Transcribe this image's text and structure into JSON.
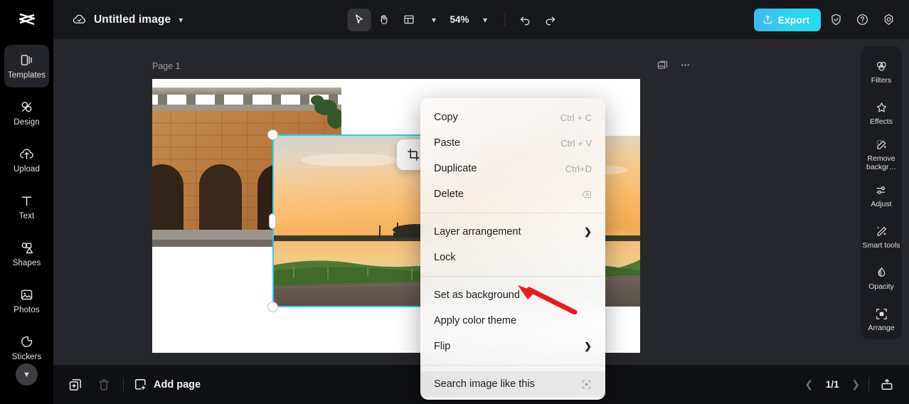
{
  "app": {
    "logo_icon": "capcut-logo-icon",
    "cloud_icon": "cloud-check-icon",
    "doc_title": "Untitled image",
    "title_chevron": "chevron-down-icon"
  },
  "toolbar": {
    "select_tool": "cursor-icon",
    "hand_tool": "hand-icon",
    "layout_tool": "layout-icon",
    "layout_chevron": "chevron-down-icon",
    "zoom_level": "54%",
    "zoom_chevron": "chevron-down-icon",
    "undo": "undo-icon",
    "redo": "redo-icon",
    "export_label": "Export",
    "export_icon": "upload-icon",
    "export_color": "#2ad5ee",
    "shield_icon": "shield-check-icon",
    "help_icon": "question-circle-icon",
    "settings_icon": "settings-gear-icon"
  },
  "sidebar": {
    "items": [
      {
        "label": "Templates",
        "icon": "templates-icon",
        "active": true
      },
      {
        "label": "Design",
        "icon": "design-icon",
        "active": false
      },
      {
        "label": "Upload",
        "icon": "upload-cloud-icon",
        "active": false
      },
      {
        "label": "Text",
        "icon": "text-icon",
        "active": false
      },
      {
        "label": "Shapes",
        "icon": "shapes-icon",
        "active": false
      },
      {
        "label": "Photos",
        "icon": "photos-icon",
        "active": false
      },
      {
        "label": "Stickers",
        "icon": "stickers-icon",
        "active": false
      }
    ],
    "more_icon": "chevron-down-icon",
    "collapse_icon": "chevron-right-icon"
  },
  "canvas": {
    "page_label": "Page 1",
    "layers_icon": "layers-image-icon",
    "more_icon": "more-horizontal-icon",
    "selection_color": "#26d3e6",
    "float_tools": [
      {
        "icon": "crop-icon"
      },
      {
        "icon": "replace-media-icon"
      },
      {
        "icon": "duplicate-icon"
      }
    ],
    "rotate_icon": "rotate-icon"
  },
  "context_menu": {
    "groups": [
      {
        "items": [
          {
            "label": "Copy",
            "shortcut": "Ctrl + C",
            "arrow": false,
            "icon": null,
            "highlight": false
          },
          {
            "label": "Paste",
            "shortcut": "Ctrl + V",
            "arrow": false,
            "icon": null,
            "highlight": false
          },
          {
            "label": "Duplicate",
            "shortcut": "Ctrl+D",
            "arrow": false,
            "icon": null,
            "highlight": false
          },
          {
            "label": "Delete",
            "shortcut": "",
            "arrow": false,
            "icon": "backspace-icon",
            "highlight": false
          }
        ]
      },
      {
        "items": [
          {
            "label": "Layer arrangement",
            "shortcut": "",
            "arrow": true,
            "icon": null,
            "highlight": false
          },
          {
            "label": "Lock",
            "shortcut": "",
            "arrow": false,
            "icon": null,
            "highlight": false
          }
        ]
      },
      {
        "items": [
          {
            "label": "Set as background",
            "shortcut": "",
            "arrow": false,
            "icon": null,
            "highlight": false
          },
          {
            "label": "Apply color theme",
            "shortcut": "",
            "arrow": false,
            "icon": null,
            "highlight": false
          },
          {
            "label": "Flip",
            "shortcut": "",
            "arrow": true,
            "icon": null,
            "highlight": false
          }
        ]
      },
      {
        "items": [
          {
            "label": "Search image like this",
            "shortcut": "",
            "arrow": false,
            "icon": "image-search-icon",
            "highlight": true
          }
        ]
      }
    ]
  },
  "annotation": {
    "arrow_color": "#e81c1c",
    "points_at": "Set as background"
  },
  "right_panel": {
    "items": [
      {
        "label": "Filters",
        "icon": "filters-icon"
      },
      {
        "label": "Effects",
        "icon": "effects-icon"
      },
      {
        "label": "Remove backgr…",
        "icon": "remove-background-icon"
      },
      {
        "label": "Adjust",
        "icon": "adjust-sliders-icon"
      },
      {
        "label": "Smart tools",
        "icon": "smart-tools-icon"
      },
      {
        "label": "Opacity",
        "icon": "opacity-drop-icon"
      },
      {
        "label": "Arrange",
        "icon": "arrange-icon"
      }
    ]
  },
  "bottom_bar": {
    "duplicate_page_icon": "duplicate-page-icon",
    "delete_page_icon": "trash-icon",
    "add_page_label": "Add page",
    "add_page_icon": "add-page-icon",
    "prev_icon": "chevron-left-icon",
    "page_counter": "1/1",
    "next_icon": "chevron-right-icon",
    "present_icon": "present-icon"
  }
}
